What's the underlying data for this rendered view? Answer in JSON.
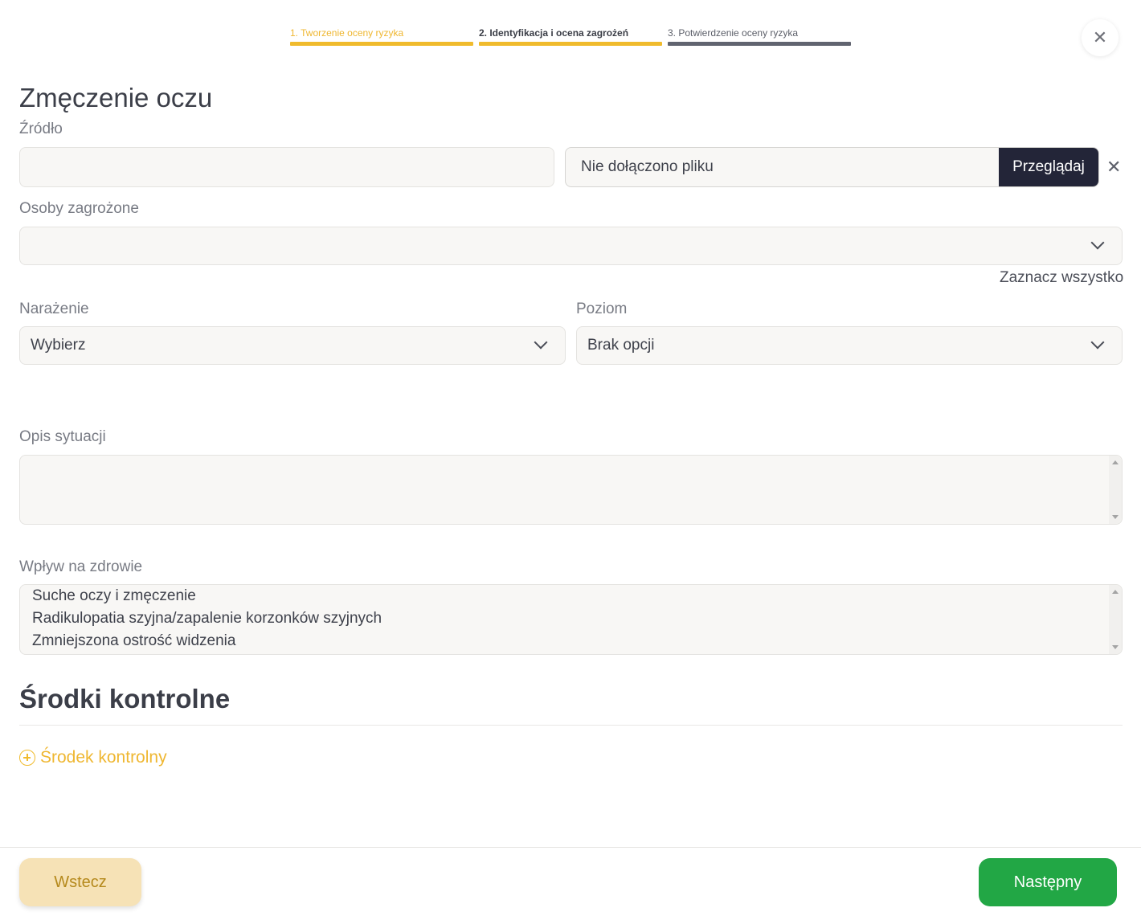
{
  "stepper": {
    "steps": [
      {
        "label": "1. Tworzenie oceny ryzyka"
      },
      {
        "label": "2. Identyfikacja i ocena zagrożeń"
      },
      {
        "label": "3. Potwierdzenie oceny ryzyka"
      }
    ]
  },
  "close_icon": "close-icon",
  "page_title": "Zmęczenie oczu",
  "source": {
    "label": "Źródło",
    "value": "",
    "file_status": "Nie dołączono pliku",
    "browse_label": "Przeglądaj"
  },
  "people_at_risk": {
    "label": "Osoby zagrożone",
    "value": "",
    "select_all": "Zaznacz wszystko"
  },
  "exposure": {
    "label": "Narażenie",
    "value": "Wybierz"
  },
  "level": {
    "label": "Poziom",
    "value": "Brak opcji"
  },
  "situation": {
    "label": "Opis sytuacji",
    "value": ""
  },
  "health_impact": {
    "label": "Wpływ na zdrowie",
    "lines": [
      "Suche oczy i zmęczenie",
      "Radikulopatia szyjna/zapalenie korzonków szyjnych",
      "Zmniejszona ostrość widzenia"
    ]
  },
  "controls": {
    "title": "Środki kontrolne",
    "add_label": "Środek kontrolny"
  },
  "footer": {
    "back_label": "Wstecz",
    "next_label": "Następny"
  },
  "colors": {
    "accent": "#f0bb2d",
    "dark_button": "#232538",
    "next_button": "#22a745",
    "back_button": "#f6e2b6"
  }
}
